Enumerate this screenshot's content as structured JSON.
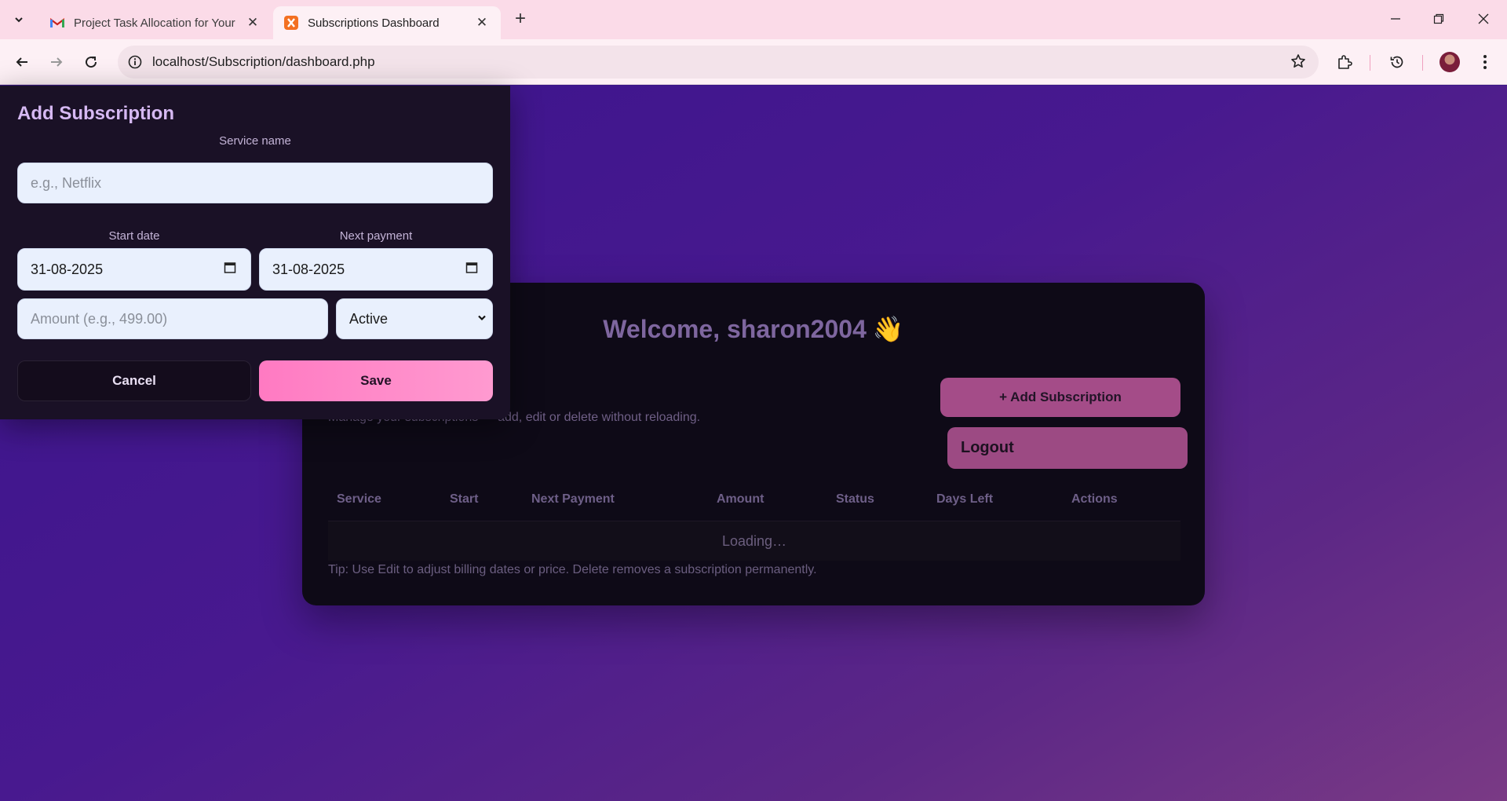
{
  "browser": {
    "tabs": [
      {
        "title": "Project Task Allocation for Your",
        "active": false,
        "favicon": "gmail-icon"
      },
      {
        "title": "Subscriptions Dashboard",
        "active": true,
        "favicon": "xampp-icon"
      }
    ],
    "url": "localhost/Subscription/dashboard.php"
  },
  "dashboard": {
    "welcome": "Welcome, sharon2004",
    "wave_emoji": "👋",
    "subtitle": "Manage your subscriptions — add, edit or delete without reloading.",
    "add_button": "+ Add Subscription",
    "logout_button": "Logout",
    "table": {
      "columns": [
        "Service",
        "Start",
        "Next Payment",
        "Amount",
        "Status",
        "Days Left",
        "Actions"
      ],
      "loading_text": "Loading…"
    },
    "tip": "Tip: Use Edit to adjust billing dates or price. Delete removes a subscription permanently."
  },
  "modal": {
    "title": "Add Subscription",
    "service_label": "Service name",
    "service_placeholder": "e.g., Netflix",
    "start_label": "Start date",
    "start_value": "31-08-2025",
    "next_label": "Next payment",
    "next_value": "31-08-2025",
    "amount_placeholder": "Amount (e.g., 499.00)",
    "status_value": "Active",
    "cancel_button": "Cancel",
    "save_button": "Save"
  },
  "colors": {
    "accent_pink": "#ff7ac2",
    "card_bg": "#0e0a17",
    "modal_bg": "#1a1126",
    "page_gradient_start": "#3a148c",
    "page_gradient_end": "#7a3a85"
  }
}
